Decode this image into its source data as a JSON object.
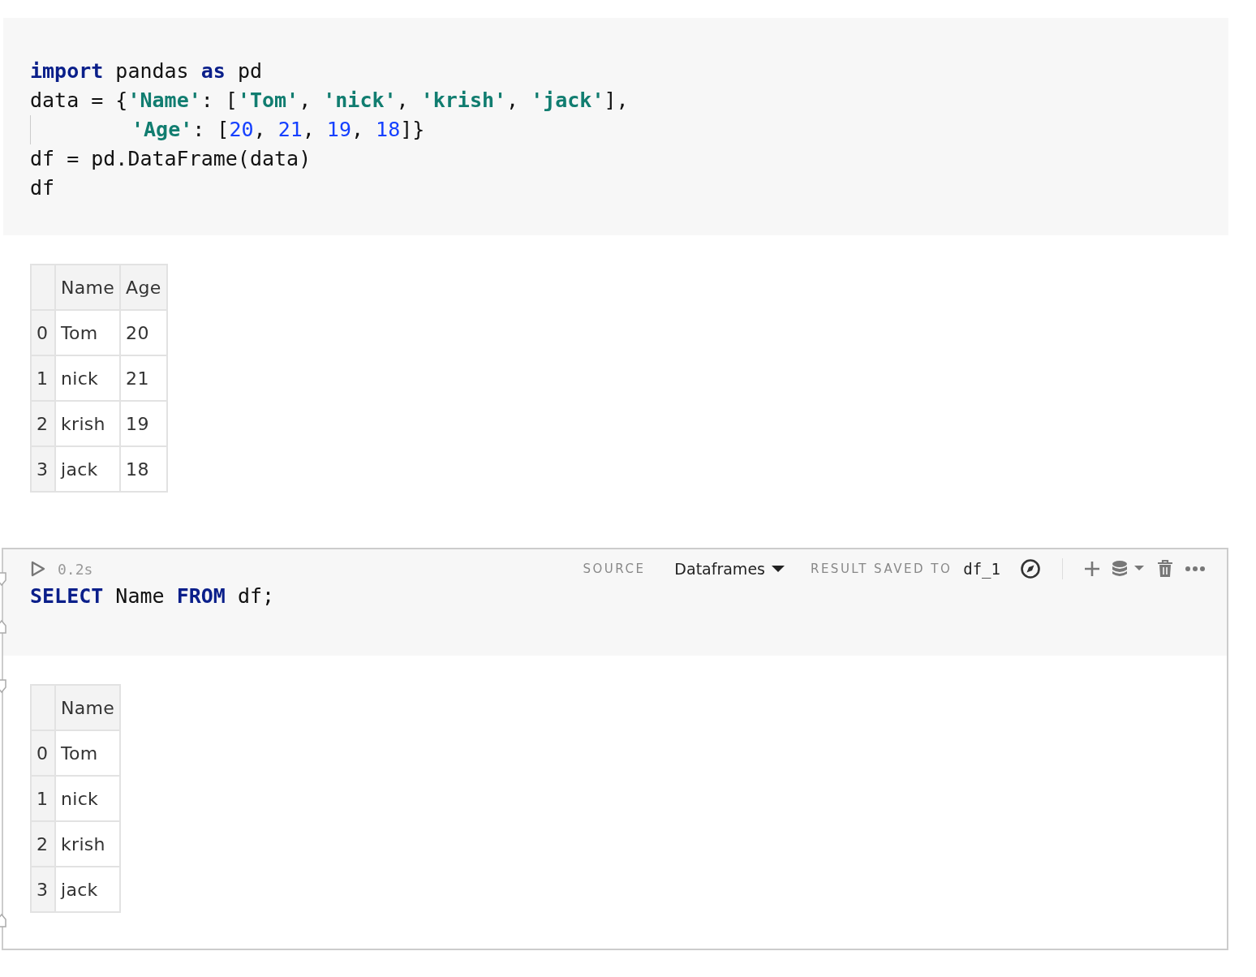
{
  "cells": [
    {
      "kind": "python",
      "code": [
        {
          "tokens": [
            {
              "keyword": "import"
            },
            {
              "text": " pandas "
            },
            {
              "keyword": "as"
            },
            {
              "text": " pd"
            }
          ]
        },
        {
          "tokens": [
            {
              "text": "data = {"
            },
            {
              "string": "'Name'"
            },
            {
              "text": ": ["
            },
            {
              "string": "'Tom'"
            },
            {
              "text": ", "
            },
            {
              "string": "'nick'"
            },
            {
              "text": ", "
            },
            {
              "string": "'krish'"
            },
            {
              "text": ", "
            },
            {
              "string": "'jack'"
            },
            {
              "text": "],"
            }
          ]
        },
        {
          "indented": true,
          "tokens": [
            {
              "string": "'Age'"
            },
            {
              "text": ": ["
            },
            {
              "number": "20"
            },
            {
              "text": ", "
            },
            {
              "number": "21"
            },
            {
              "text": ", "
            },
            {
              "number": "19"
            },
            {
              "text": ", "
            },
            {
              "number": "18"
            },
            {
              "text": "]}"
            }
          ]
        },
        {
          "tokens": [
            {
              "text": "df = pd.DataFrame(data)"
            }
          ]
        },
        {
          "tokens": [
            {
              "text": "df"
            }
          ]
        }
      ],
      "output": {
        "columns": [
          "Name",
          "Age"
        ],
        "rows": [
          {
            "index": "0",
            "cells": [
              "Tom",
              "20"
            ]
          },
          {
            "index": "1",
            "cells": [
              "nick",
              "21"
            ]
          },
          {
            "index": "2",
            "cells": [
              "krish",
              "19"
            ]
          },
          {
            "index": "3",
            "cells": [
              "jack",
              "18"
            ]
          }
        ]
      }
    },
    {
      "kind": "sql",
      "toolbar": {
        "time": "0.2s",
        "source_label": "SOURCE",
        "source": "Dataframes",
        "result_label": "RESULT SAVED TO",
        "result_var": "df_1"
      },
      "code": [
        {
          "tokens": [
            {
              "keyword": "SELECT"
            },
            {
              "text": " Name "
            },
            {
              "keyword": "FROM"
            },
            {
              "text": " df;"
            }
          ]
        }
      ],
      "output": {
        "columns": [
          "Name"
        ],
        "rows": [
          {
            "index": "0",
            "cells": [
              "Tom"
            ]
          },
          {
            "index": "1",
            "cells": [
              "nick"
            ]
          },
          {
            "index": "2",
            "cells": [
              "krish"
            ]
          },
          {
            "index": "3",
            "cells": [
              "jack"
            ]
          }
        ]
      }
    }
  ]
}
